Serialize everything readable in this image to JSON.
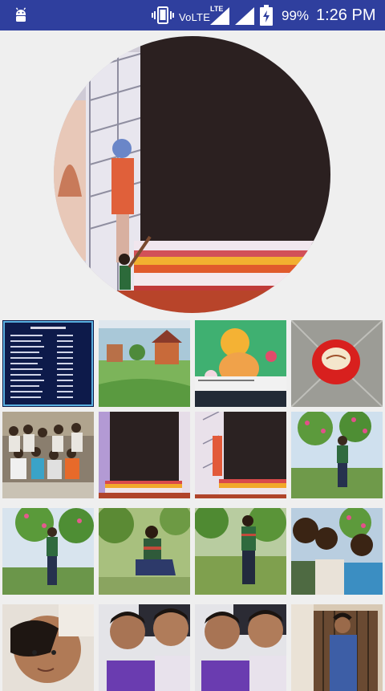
{
  "status_bar": {
    "network_label": "VoLTE",
    "lte_label": "LTE",
    "battery_percent": "99%",
    "battery_level": 0.99,
    "time": "1:26 PM",
    "icons": [
      "android-icon",
      "vibrate-icon",
      "signal-icon",
      "signal-icon",
      "battery-charging-icon"
    ],
    "background_color": "#2f3f9e"
  },
  "profile": {
    "image": "circular-profile-photo"
  },
  "gallery": {
    "rows": 4,
    "columns": 4,
    "tiles": [
      "text-list-image",
      "village-painting",
      "cartoon-painting",
      "cake-photo",
      "group-photo",
      "statue-photo",
      "statue-photo-2",
      "person-garden-photo",
      "person-garden-photo-2",
      "person-sitting-photo",
      "person-standing-photo",
      "friends-selfie",
      "friends-selfie-closeup",
      "two-friends-selfie",
      "two-friends-selfie-2",
      "person-doorway-photo"
    ]
  }
}
